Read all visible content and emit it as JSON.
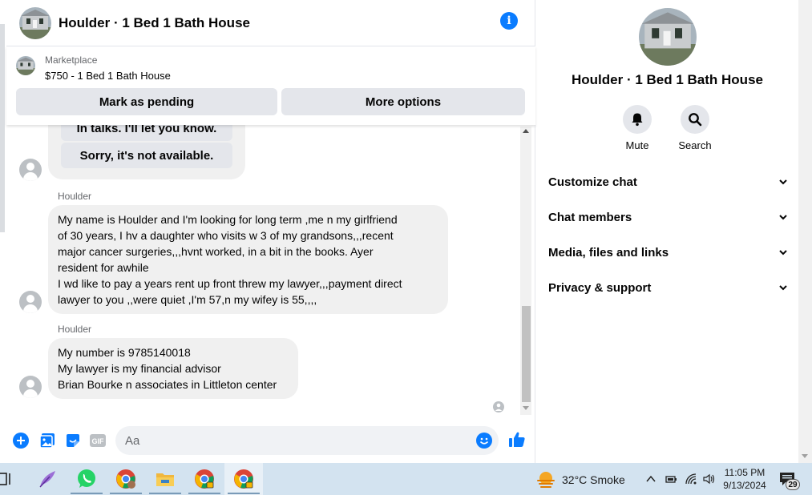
{
  "header": {
    "title": "Houlder · 1 Bed 1 Bath House"
  },
  "marketplace": {
    "label": "Marketplace",
    "item": "$750 - 1 Bed 1 Bath House",
    "mark_pending_label": "Mark as pending",
    "more_options_label": "More options"
  },
  "messages": {
    "quick_reply_partial": "In talks. I'll let you know.",
    "quick_reply_not_available": "Sorry, it's not available.",
    "msg1": {
      "sender": "Houlder",
      "text": "My name is Houlder and I'm looking for long term ,me n my girlfriend\nof 30 years, I hv a daughter who visits w 3 of my grandsons,,,recent\nmajor cancer surgeries,,,hvnt worked, in a bit in the books.  Ayer\nresident for awhile\n I wd like to pay a years rent up front threw my lawyer,,,payment direct\nlawyer to you ,,were quiet ,I'm 57,n my wifey is 55,,,,"
    },
    "msg2": {
      "sender": "Houlder",
      "text": "My number is 9785140018\n My lawyer is my financial advisor\nBrian Bourke n associates in Littleton center"
    }
  },
  "composer": {
    "placeholder": "Aa"
  },
  "info_panel": {
    "title": "Houlder · 1 Bed 1 Bath House",
    "actions": {
      "mute": "Mute",
      "search": "Search"
    },
    "sections": {
      "customize": "Customize chat",
      "members": "Chat members",
      "media": "Media, files and links",
      "privacy": "Privacy & support"
    }
  },
  "taskbar": {
    "weather": "32°C  Smoke",
    "time": "11:05 PM",
    "date": "9/13/2024",
    "notifications": "29"
  },
  "colors": {
    "accent": "#0a7cff",
    "bubble": "#f0f0f0",
    "button": "#e4e6eb",
    "taskbar": "#d3e3f0"
  }
}
